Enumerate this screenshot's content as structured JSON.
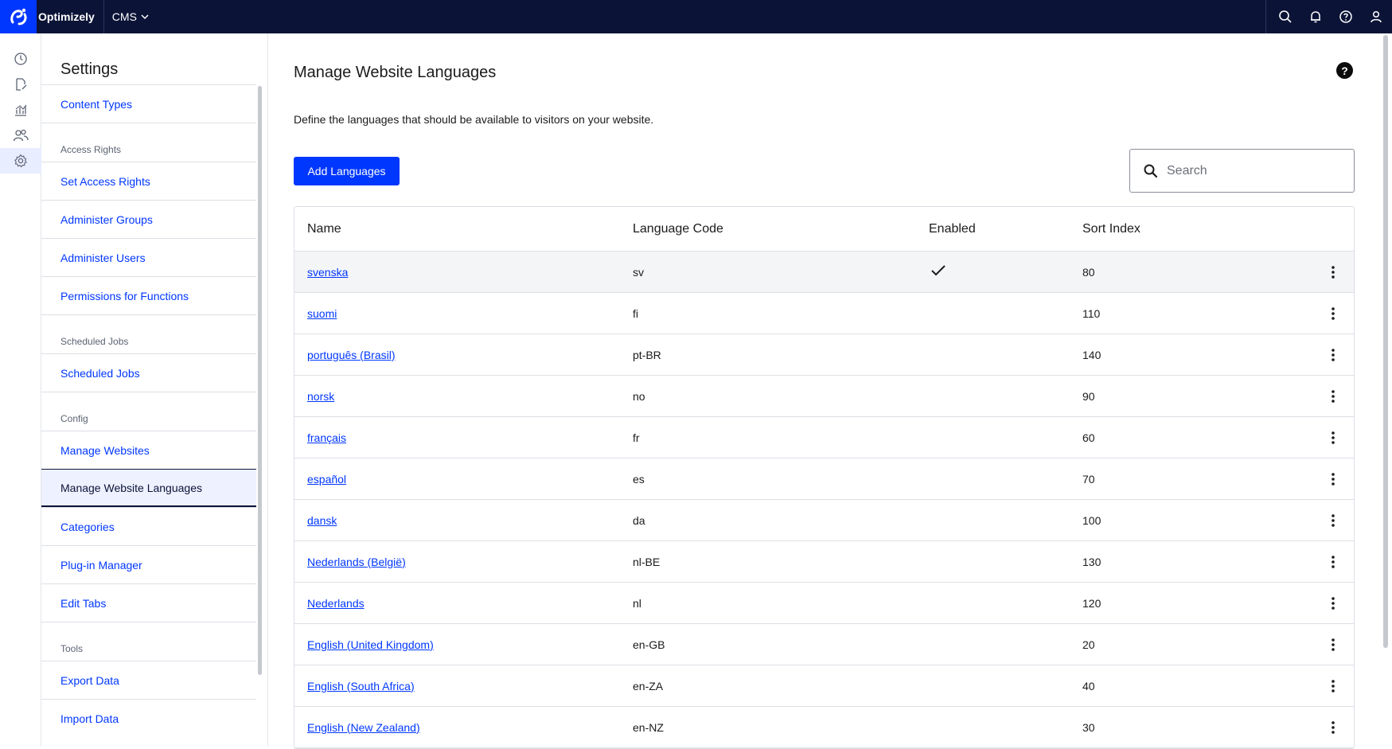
{
  "topbar": {
    "brand": "Optimizely",
    "product": "CMS"
  },
  "settings": {
    "title": "Settings",
    "items": [
      {
        "type": "item",
        "label": "Content Types"
      },
      {
        "type": "group",
        "label": "Access Rights"
      },
      {
        "type": "item",
        "label": "Set Access Rights"
      },
      {
        "type": "item",
        "label": "Administer Groups"
      },
      {
        "type": "item",
        "label": "Administer Users"
      },
      {
        "type": "item",
        "label": "Permissions for Functions"
      },
      {
        "type": "group",
        "label": "Scheduled Jobs"
      },
      {
        "type": "item",
        "label": "Scheduled Jobs"
      },
      {
        "type": "group",
        "label": "Config"
      },
      {
        "type": "item",
        "label": "Manage Websites"
      },
      {
        "type": "item",
        "label": "Manage Website Languages",
        "active": true
      },
      {
        "type": "item",
        "label": "Categories"
      },
      {
        "type": "item",
        "label": "Plug-in Manager"
      },
      {
        "type": "item",
        "label": "Edit Tabs"
      },
      {
        "type": "group",
        "label": "Tools"
      },
      {
        "type": "item",
        "label": "Export Data"
      },
      {
        "type": "item",
        "label": "Import Data"
      }
    ]
  },
  "main": {
    "title": "Manage Website Languages",
    "description": "Define the languages that should be available to visitors on your website.",
    "add_button": "Add Languages",
    "search_placeholder": "Search",
    "columns": [
      "Name",
      "Language Code",
      "Enabled",
      "Sort Index"
    ],
    "rows": [
      {
        "name": "svenska",
        "code": "sv",
        "enabled": true,
        "sort": "80"
      },
      {
        "name": "suomi",
        "code": "fi",
        "enabled": false,
        "sort": "110"
      },
      {
        "name": "português (Brasil)",
        "code": "pt-BR",
        "enabled": false,
        "sort": "140"
      },
      {
        "name": "norsk",
        "code": "no",
        "enabled": false,
        "sort": "90"
      },
      {
        "name": "français",
        "code": "fr",
        "enabled": false,
        "sort": "60"
      },
      {
        "name": "español",
        "code": "es",
        "enabled": false,
        "sort": "70"
      },
      {
        "name": "dansk",
        "code": "da",
        "enabled": false,
        "sort": "100"
      },
      {
        "name": "Nederlands (België)",
        "code": "nl-BE",
        "enabled": false,
        "sort": "130"
      },
      {
        "name": "Nederlands",
        "code": "nl",
        "enabled": false,
        "sort": "120"
      },
      {
        "name": "English (United Kingdom)",
        "code": "en-GB",
        "enabled": false,
        "sort": "20"
      },
      {
        "name": "English (South Africa)",
        "code": "en-ZA",
        "enabled": false,
        "sort": "40"
      },
      {
        "name": "English (New Zealand)",
        "code": "en-NZ",
        "enabled": false,
        "sort": "30"
      }
    ]
  },
  "colors": {
    "topbar": "#0b1337",
    "accent": "#0037ff"
  },
  "icons": {
    "rail": [
      "clock-icon",
      "file-edit-icon",
      "analytics-icon",
      "users-icon",
      "gear-icon"
    ],
    "topbar": [
      "search-icon",
      "bell-icon",
      "help-icon",
      "user-icon"
    ]
  }
}
